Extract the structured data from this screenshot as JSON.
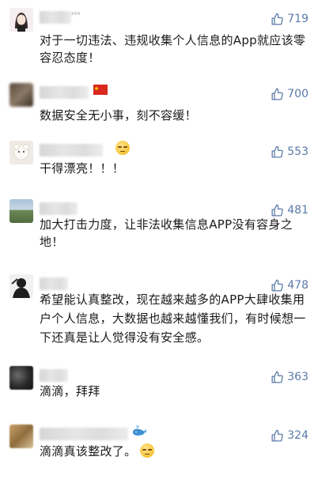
{
  "accent_color": "#5b7aa8",
  "comments": [
    {
      "likes": "719",
      "text": "对于一切违法、违规收集个人信息的App就应该零容忍态度！",
      "nick_suffix": "ᶻᶻᵒ",
      "avatar": "girl"
    },
    {
      "likes": "700",
      "text": "数据安全无小事，刻不容缓！",
      "nick_suffix": "🇨🇳",
      "avatar": "blurred"
    },
    {
      "likes": "553",
      "text": "干得漂亮！！！",
      "nick_suffix": "",
      "avatar": "plush"
    },
    {
      "likes": "481",
      "text": "加大打击力度，让非法收集信息APP没有容身之地！",
      "nick_suffix": "",
      "avatar": "landscape"
    },
    {
      "likes": "478",
      "text": "希望能认真整改，现在越来越多的APP大肆收集用户个人信息，大数据也越来越懂我们，有时候想一下还真是让人觉得没有安全感。",
      "nick_suffix": "",
      "avatar": "silhouette"
    },
    {
      "likes": "363",
      "text": "滴滴，拜拜",
      "nick_suffix": "",
      "avatar": "dark"
    },
    {
      "likes": "324",
      "text": "滴滴真该整改了。",
      "nick_suffix": "🐳",
      "avatar": "photo"
    }
  ]
}
